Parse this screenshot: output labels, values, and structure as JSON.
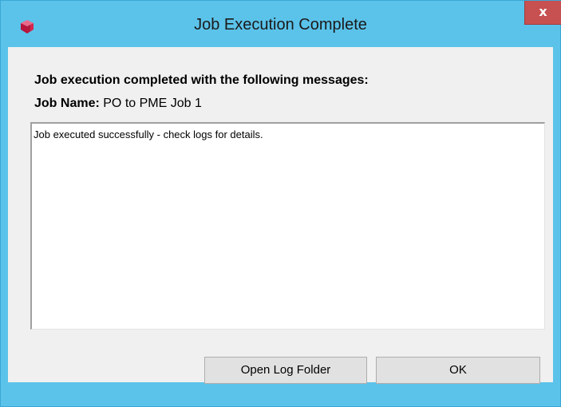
{
  "window": {
    "title": "Job Execution Complete",
    "close_glyph": "x",
    "app_icon": "cube-icon"
  },
  "content": {
    "heading": "Job execution completed with the following messages:",
    "job_name_label": "Job Name:",
    "job_name_value": "PO to PME Job 1",
    "messages_text": "Job executed successfully - check logs for details."
  },
  "buttons": {
    "open_log_folder": "Open Log Folder",
    "ok": "OK"
  },
  "colors": {
    "titlebar": "#5bc3ea",
    "close_button": "#c75050",
    "client_background": "#f0f0f0"
  }
}
